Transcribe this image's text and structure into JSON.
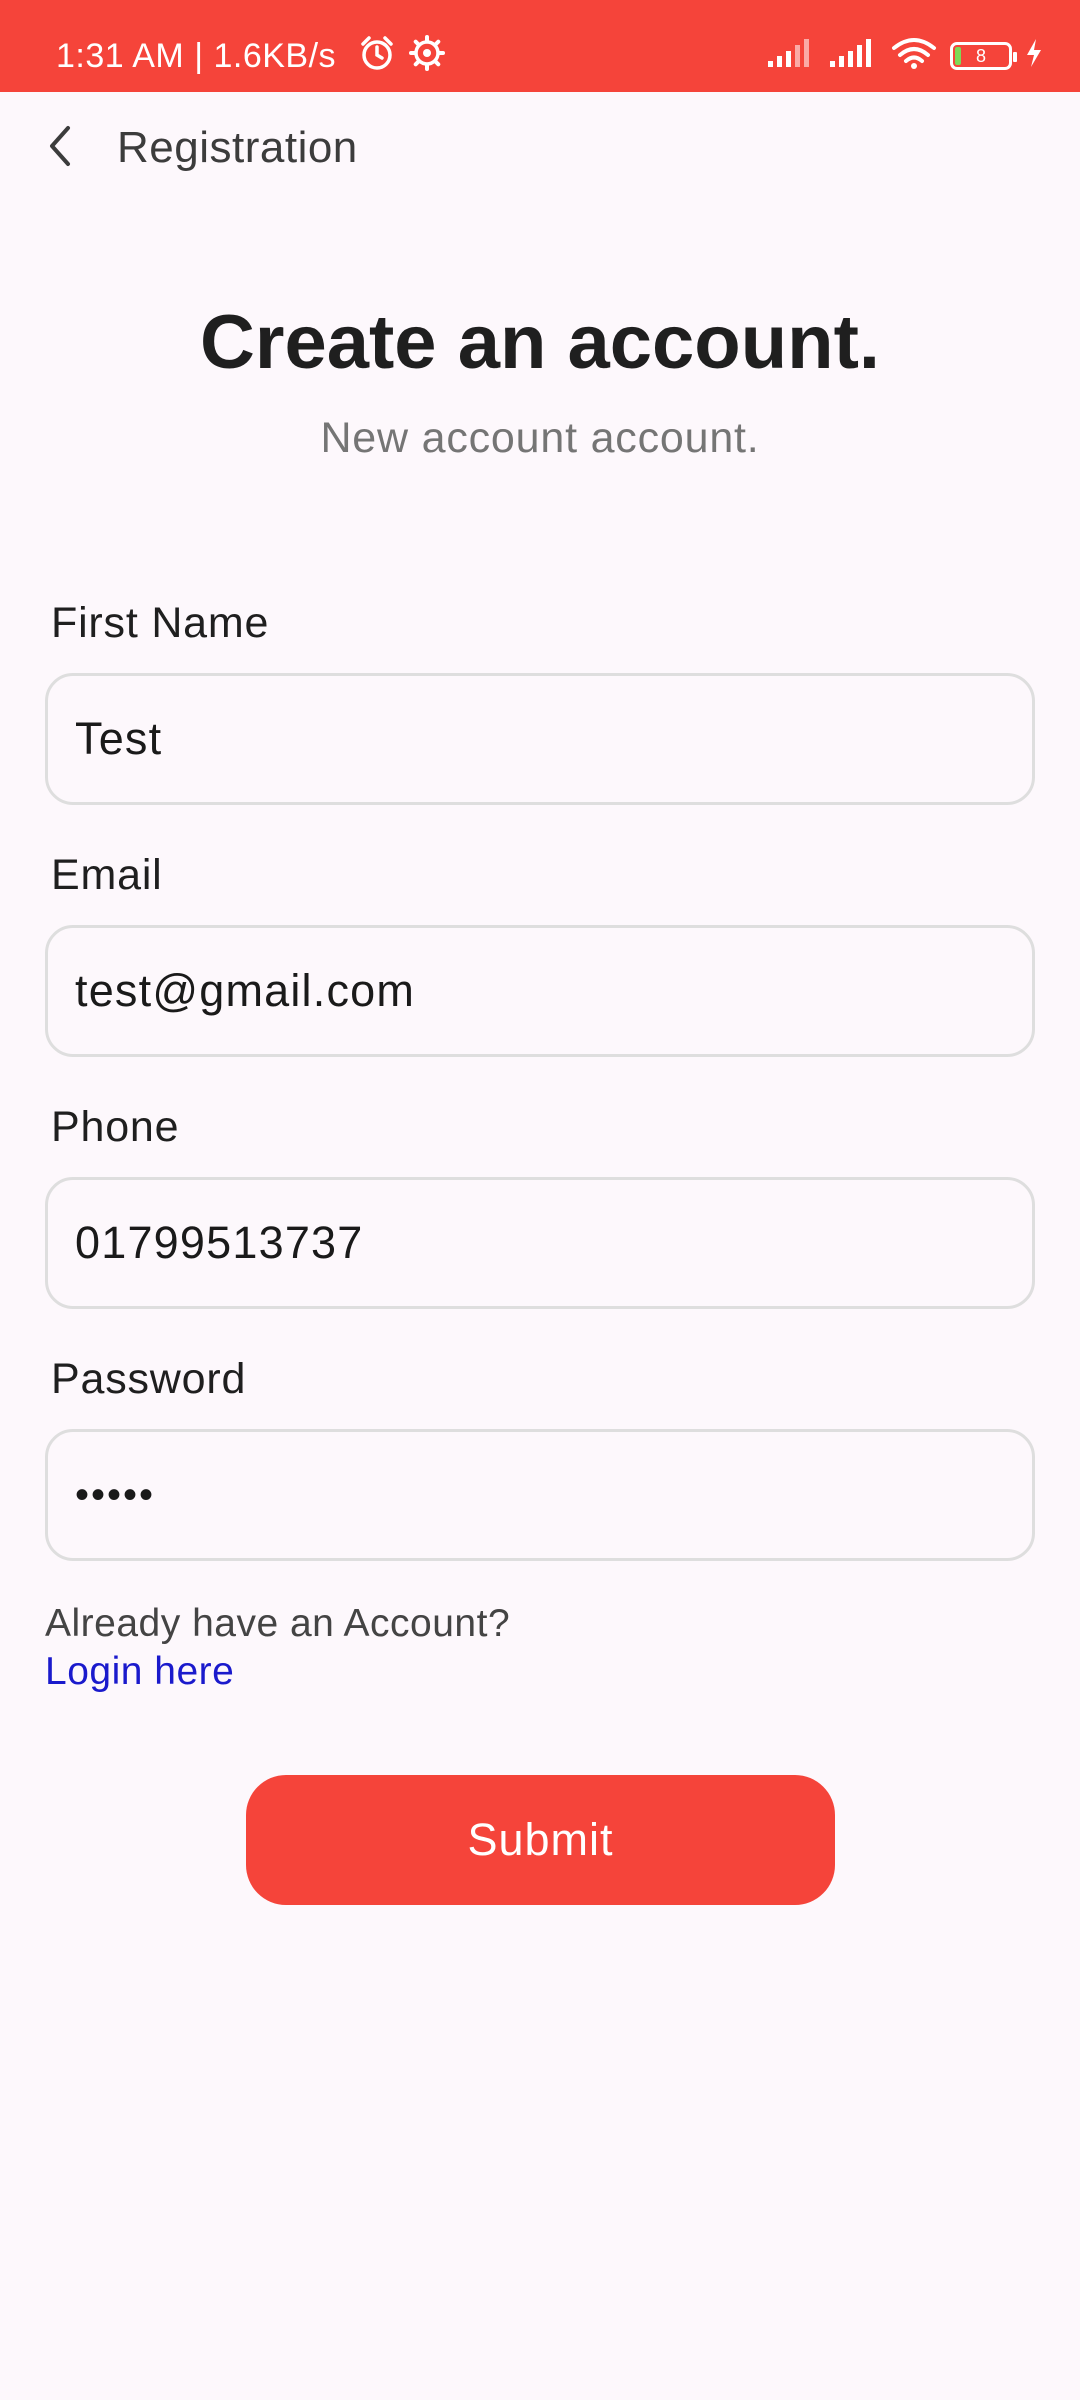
{
  "status_bar": {
    "time_text": "1:31 AM | 1.6KB/s",
    "battery_level": "8",
    "background_color": "#f5443a",
    "icons": [
      "alarm-icon",
      "settings-icon",
      "signal-icon",
      "wifi-icon",
      "battery-icon",
      "charging-icon"
    ]
  },
  "app_bar": {
    "title": "Registration",
    "back_icon": "chevron-left-icon"
  },
  "header": {
    "title": "Create an account.",
    "subtitle": "New account account."
  },
  "form": {
    "first_name": {
      "label": "First Name",
      "value": "Test"
    },
    "email": {
      "label": "Email",
      "value": "test@gmail.com"
    },
    "phone": {
      "label": "Phone",
      "value": "01799513737"
    },
    "password": {
      "label": "Password",
      "value": "•••••"
    }
  },
  "login": {
    "prompt": "Already have an Account?",
    "link": "Login here"
  },
  "submit": {
    "label": "Submit",
    "color": "#f5443a"
  }
}
